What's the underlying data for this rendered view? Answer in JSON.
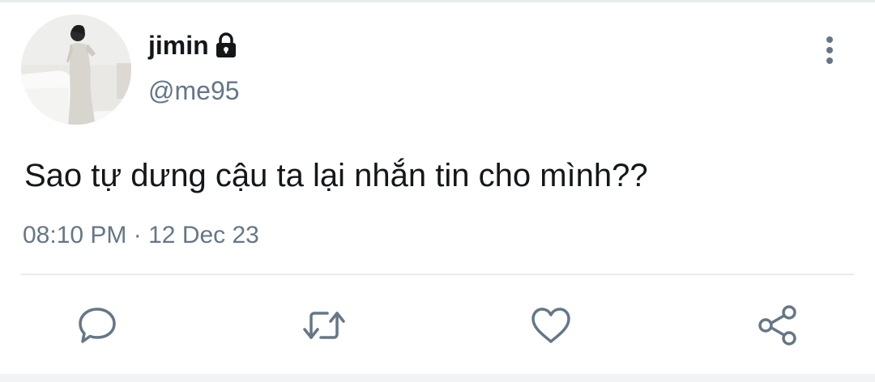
{
  "tweet": {
    "display_name": "jimin",
    "handle": "@me95",
    "text": "Sao tự dưng cậu ta lại nhắn tin cho mình??",
    "time": "08:10 PM",
    "separator": "·",
    "date": "12 Dec 23"
  },
  "icons": {
    "lock": "lock-icon",
    "more": "vertical-dots-icon",
    "reply": "speech-bubble-icon",
    "retweet": "retweet-icon",
    "like": "heart-icon",
    "share": "share-icon"
  },
  "colors": {
    "text_primary": "#14171a",
    "text_secondary": "#657786",
    "icon": "#657786",
    "divider": "#e6ecf0"
  }
}
